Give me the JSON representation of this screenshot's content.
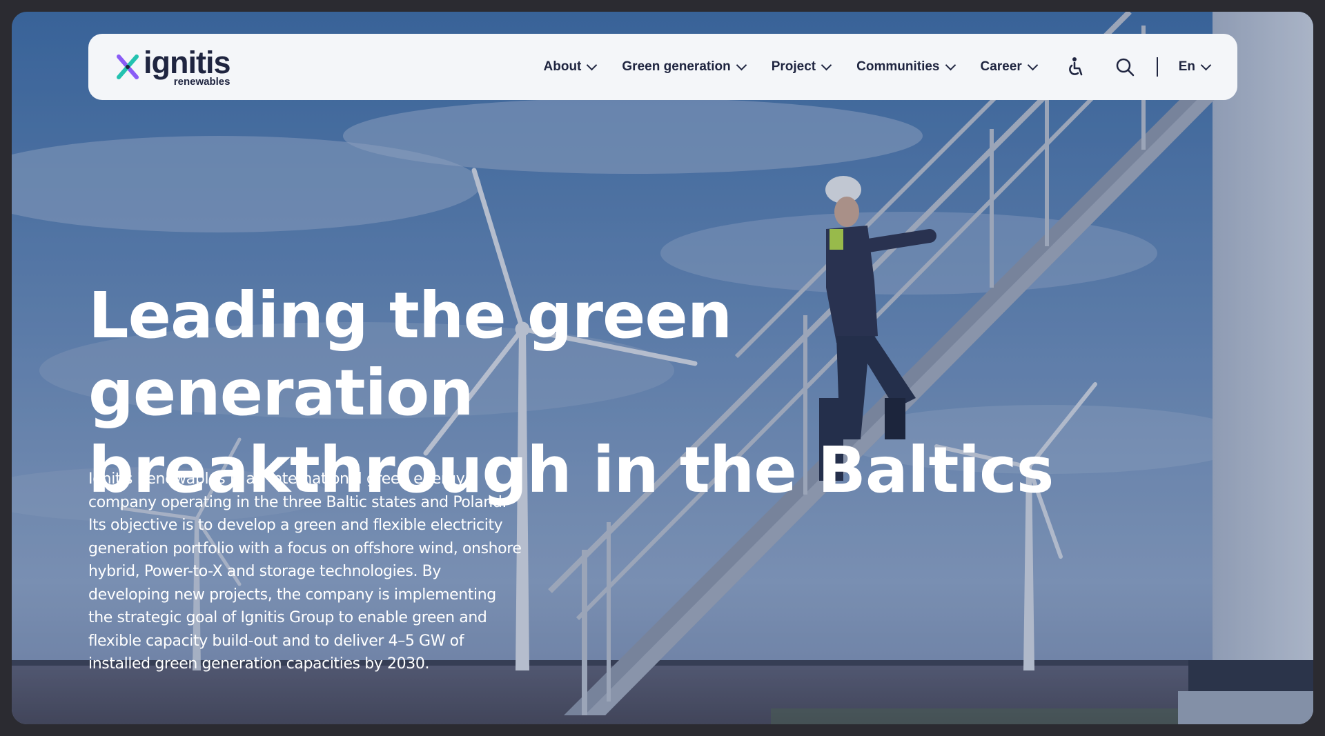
{
  "brand": {
    "name": "ignitis",
    "subtitle": "renewables"
  },
  "nav": {
    "items": [
      {
        "label": "About"
      },
      {
        "label": "Green generation"
      },
      {
        "label": "Project"
      },
      {
        "label": "Communities"
      },
      {
        "label": "Career"
      }
    ],
    "accessibility_icon": "accessibility-icon",
    "search_icon": "search-icon",
    "language": "En"
  },
  "hero": {
    "headline_line1": "Leading the green generation",
    "headline_line2": "breakthrough in the Baltics",
    "description": "Ignitis Renewables is an international green energy company operating in the three Baltic states and Poland. Its objective is to develop a green and flexible electricity generation portfolio with a focus on offshore wind, onshore hybrid, Power-to-X and storage technologies. By developing new projects, the company is implementing the strategic goal of Ignitis Group to enable green and flexible capacity build-out and to deliver 4–5 GW of installed green generation capacities by 2030."
  },
  "colors": {
    "brand_dark": "#1f2540",
    "logo_teal": "#23c2b0",
    "logo_purple": "#8a5cf6",
    "sky_overlay": "#3d5f8c"
  }
}
